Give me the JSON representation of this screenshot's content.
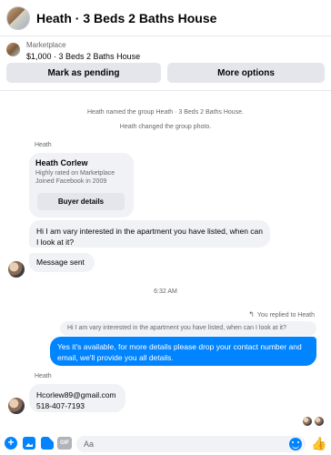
{
  "header": {
    "title": "Heath · 3 Beds 2 Baths House"
  },
  "listing": {
    "label": "Marketplace",
    "price_title": "$1,000 · 3 Beds 2 Baths House",
    "mark_pending": "Mark as pending",
    "more_options": "More options"
  },
  "system": {
    "named_group": "Heath named the group Heath · 3 Beds 2 Baths House.",
    "changed_photo": "Heath changed the group photo."
  },
  "card": {
    "sender": "Heath",
    "name": "Heath Corlew",
    "line1": "Highly rated on Marketplace",
    "line2": "Joined Facebook in 2009",
    "button": "Buyer details"
  },
  "messages": {
    "incoming1": "Hi I am vary interested in the apartment you have listed, when can I look at it?",
    "incoming2": "Message sent",
    "timestamp": "6:32 AM",
    "replied_label": "You replied to Heath",
    "quoted": "Hi I am vary interested in the apartment you have listed, when can I look at it?",
    "outgoing": "Yes it's available, for more details please drop your contact number and email, we'll provide you all details.",
    "sender2": "Heath",
    "incoming3_line1": "Hcorlew89@gmail.com",
    "incoming3_line2": "518-407-7193"
  },
  "composer": {
    "placeholder": "Aa",
    "gif_label": "GIF",
    "plus_label": "+",
    "like_label": "👍"
  },
  "icons": {
    "plus": "plus-circle-icon",
    "photo": "photo-icon",
    "sticker": "sticker-icon",
    "gif": "gif-icon",
    "emoji": "emoji-icon",
    "like": "thumbs-up-icon",
    "reply": "reply-arrow-icon"
  },
  "colors": {
    "accent": "#0084ff",
    "bubble_in": "#f0f2f5",
    "secondary_text": "#65676b"
  }
}
